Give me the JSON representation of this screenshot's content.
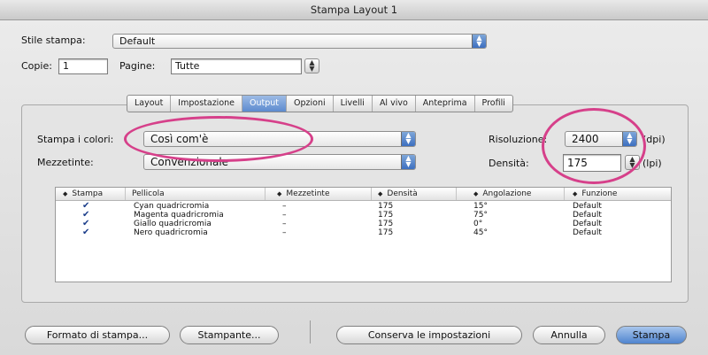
{
  "window": {
    "title": "Stampa Layout 1"
  },
  "print_style": {
    "label": "Stile stampa:",
    "value": "Default"
  },
  "copies": {
    "label": "Copie:",
    "value": "1"
  },
  "pages": {
    "label": "Pagine:",
    "value": "Tutte"
  },
  "tabs": [
    {
      "label": "Layout",
      "active": false
    },
    {
      "label": "Impostazione",
      "active": false
    },
    {
      "label": "Output",
      "active": true
    },
    {
      "label": "Opzioni",
      "active": false
    },
    {
      "label": "Livelli",
      "active": false
    },
    {
      "label": "Al vivo",
      "active": false
    },
    {
      "label": "Anteprima",
      "active": false
    },
    {
      "label": "Profili",
      "active": false
    }
  ],
  "output": {
    "print_colors_label": "Stampa i colori:",
    "print_colors_value": "Così com'è",
    "halftone_label": "Mezzetinte:",
    "halftone_value": "Convenzionale",
    "resolution_label": "Risoluzione:",
    "resolution_value": "2400",
    "resolution_unit": "(dpi)",
    "density_label": "Densità:",
    "density_value": "175",
    "density_unit": "(lpi)"
  },
  "table": {
    "columns": [
      "Stampa",
      "Pellicola",
      "Mezzetinte",
      "Densità",
      "Angolazione",
      "Funzione"
    ],
    "rows": [
      {
        "print": true,
        "film": "Cyan quadricromia",
        "halftone": "–",
        "density": "175",
        "angle": "15°",
        "function": "Default"
      },
      {
        "print": true,
        "film": "Magenta quadricromia",
        "halftone": "–",
        "density": "175",
        "angle": "75°",
        "function": "Default"
      },
      {
        "print": true,
        "film": "Giallo quadricromia",
        "halftone": "–",
        "density": "175",
        "angle": "0°",
        "function": "Default"
      },
      {
        "print": true,
        "film": "Nero quadricromia",
        "halftone": "–",
        "density": "175",
        "angle": "45°",
        "function": "Default"
      }
    ]
  },
  "buttons": {
    "page_format": "Formato di stampa...",
    "printer": "Stampante...",
    "save_settings": "Conserva le impostazioni",
    "cancel": "Annulla",
    "print": "Stampa"
  },
  "colors": {
    "highlight_ellipse": "#d6408a",
    "accent": "#5d8bcf"
  }
}
